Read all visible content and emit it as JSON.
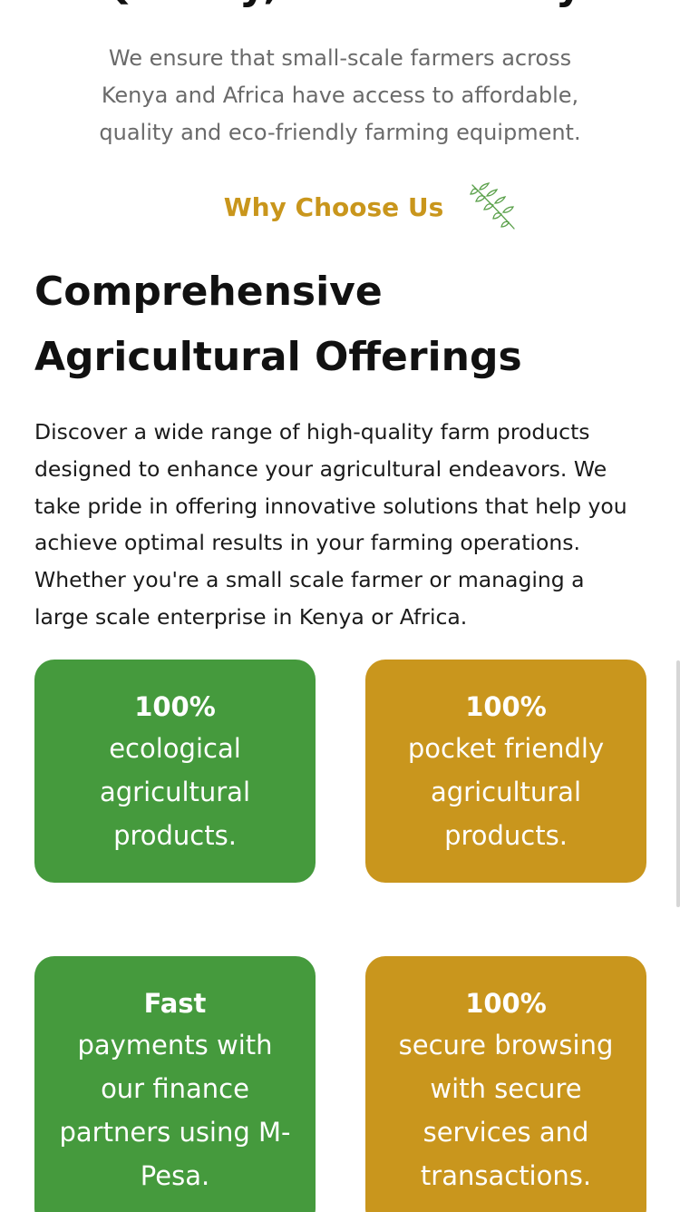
{
  "hero": {
    "cut_heading": "Quality, Eco-Friendly",
    "mission_text": "We ensure that small-scale farmers across Kenya and Africa have access to affordable, quality and eco-friendly farming equipment."
  },
  "why_section": {
    "label": "Why Choose Us",
    "icon": "leaf-sprig-icon",
    "title": "Comprehensive Agricultural Offerings",
    "body": "Discover a wide range of high-quality farm products designed to enhance your agricultural endeavors. We take pride in offering innovative solutions that help you achieve optimal results in your farming operations. Whether you're a small scale farmer or managing a large scale enterprise in Kenya or Africa."
  },
  "features": [
    {
      "headline": "100%",
      "text": "ecological agricultural products.",
      "color": "#459a3d"
    },
    {
      "headline": "100%",
      "text": "pocket friendly agricultural products.",
      "color": "#c9961d"
    },
    {
      "headline": "Fast",
      "text": "payments with our finance partners using M-Pesa.",
      "color": "#459a3d"
    },
    {
      "headline": "100%",
      "text": "secure browsing with secure services and transactions.",
      "color": "#c9961d"
    }
  ],
  "colors": {
    "accent_gold": "#c9961c",
    "accent_green": "#459a3d",
    "heading": "#111111",
    "muted_text": "#6a6a6a"
  }
}
